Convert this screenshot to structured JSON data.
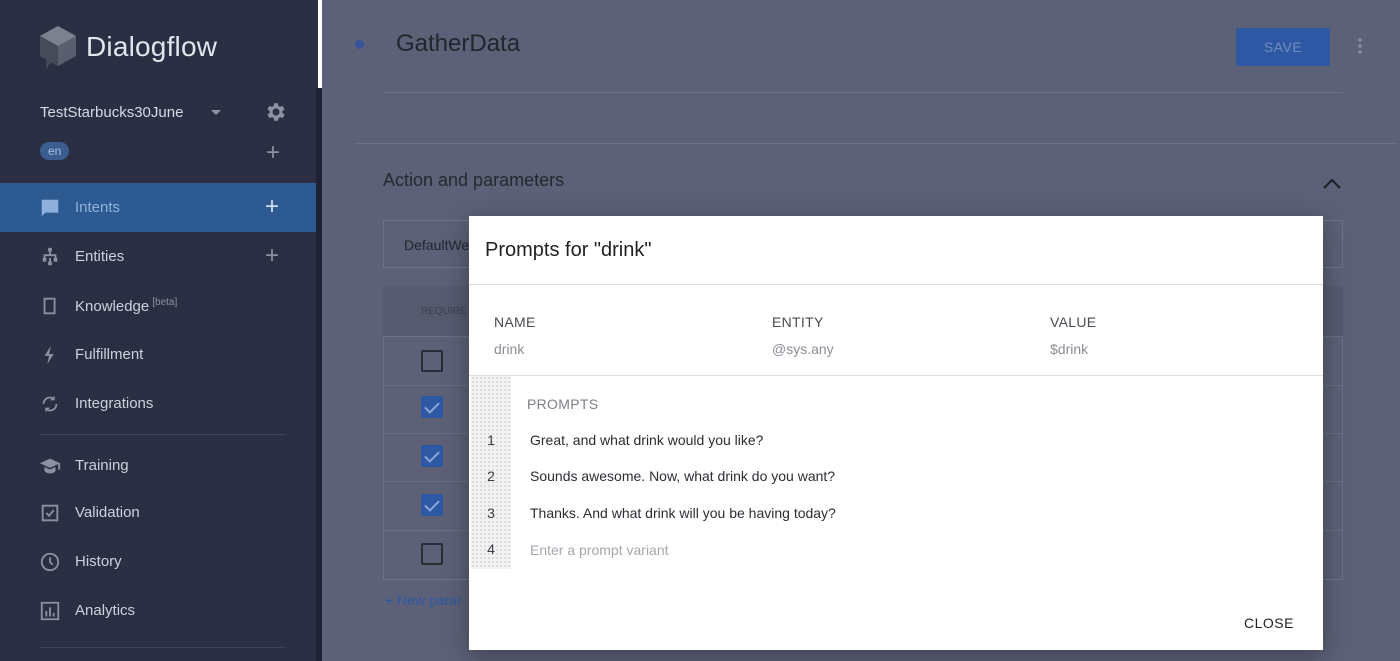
{
  "app": {
    "name": "Dialogflow"
  },
  "sidebar": {
    "agent_name": "TestStarbucks30June",
    "language": "en",
    "items": [
      {
        "label": "Intents",
        "icon": "chat-icon",
        "active": true
      },
      {
        "label": "Entities",
        "icon": "hierarchy-icon"
      },
      {
        "label": "Knowledge",
        "badge": "[beta]",
        "icon": "book-icon"
      },
      {
        "label": "Fulfillment",
        "icon": "bolt-icon"
      },
      {
        "label": "Integrations",
        "icon": "sync-icon"
      },
      {
        "label": "Training",
        "icon": "graduation-cap-icon"
      },
      {
        "label": "Validation",
        "icon": "checkbox-icon"
      },
      {
        "label": "History",
        "icon": "clock-icon"
      },
      {
        "label": "Analytics",
        "icon": "bar-chart-icon"
      }
    ]
  },
  "header": {
    "intent_name": "GatherData",
    "save_label": "SAVE"
  },
  "action_section": {
    "title": "Action and parameters",
    "action_value": "DefaultWe",
    "table_header_required": "REQUIRE",
    "new_parameter_label": "+ New parar",
    "required_checks": [
      false,
      true,
      true,
      true,
      false
    ]
  },
  "dialog": {
    "title": "Prompts for \"drink\"",
    "columns": {
      "name": "NAME",
      "entity": "ENTITY",
      "value": "VALUE"
    },
    "param": {
      "name": "drink",
      "entity": "@sys.any",
      "value": "$drink"
    },
    "prompts_label": "PROMPTS",
    "prompts": [
      {
        "n": "1",
        "text": "Great, and what drink would you like?"
      },
      {
        "n": "2",
        "text": "Sounds awesome. Now, what drink do you want?"
      },
      {
        "n": "3",
        "text": "Thanks. And what drink will you be having today?"
      }
    ],
    "new_prompt": {
      "n": "4",
      "placeholder": "Enter a prompt variant"
    },
    "close_label": "CLOSE"
  },
  "colors": {
    "sidebar_bg": "#2a2f43",
    "active_item": "#2c5a91",
    "accent": "#2e58a3",
    "overlay_main": "#5d6177"
  }
}
